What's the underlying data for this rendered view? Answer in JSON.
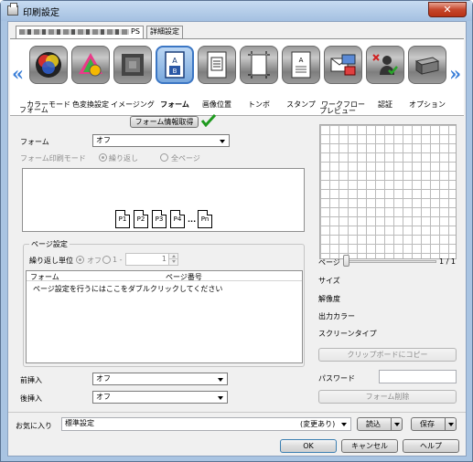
{
  "window": {
    "title": "印刷設定",
    "close_label": "✕"
  },
  "tabs": {
    "printer_tab_suffix": "PS",
    "detail_tab": "詳細設定"
  },
  "toolbar": {
    "items": [
      {
        "label": "カラーモード",
        "icon": "color-mode-icon"
      },
      {
        "label": "色変換設定",
        "icon": "color-conversion-icon"
      },
      {
        "label": "イメージング",
        "icon": "imaging-icon"
      },
      {
        "label": "フォーム",
        "icon": "form-icon",
        "selected": true
      },
      {
        "label": "画像位置",
        "icon": "image-position-icon"
      },
      {
        "label": "トンボ",
        "icon": "crop-marks-icon"
      },
      {
        "label": "スタンプ",
        "icon": "stamp-icon"
      },
      {
        "label": "ワークフロー",
        "icon": "workflow-icon"
      },
      {
        "label": "認証",
        "icon": "authentication-icon"
      },
      {
        "label": "オプション",
        "icon": "option-icon"
      }
    ],
    "prev_arrow": "«",
    "next_arrow": "»"
  },
  "form_group": {
    "title": "フォーム",
    "get_info_button": "フォーム情報取得",
    "form_label": "フォーム",
    "form_value": "オフ",
    "print_mode_label": "フォーム印刷モード",
    "mode_repeat": "繰り返し",
    "mode_all_pages": "全ページ",
    "page_icons": [
      "P1",
      "P2",
      "P3",
      "P4",
      "...",
      "Pn"
    ]
  },
  "page_settings": {
    "title": "ページ設定",
    "repeat_unit_label": "繰り返し単位",
    "off_label": "オフ",
    "range_label": "1 -",
    "range_value": "1",
    "col_form": "フォーム",
    "col_page_number": "ページ番号",
    "placeholder": "ページ設定を行うにはここをダブルクリックしてください"
  },
  "insert": {
    "front_label": "前挿入",
    "front_value": "オフ",
    "back_label": "後挿入",
    "back_value": "オフ"
  },
  "preview": {
    "title": "プレビュー",
    "page_label": "ページ",
    "page_indicator": "1 / 1",
    "size_label": "サイズ",
    "resolution_label": "解像度",
    "output_color_label": "出力カラー",
    "screen_type_label": "スクリーンタイプ",
    "copy_button": "クリップボードにコピー",
    "password_label": "パスワード",
    "password_value": "",
    "delete_form_button": "フォーム削除"
  },
  "favorites": {
    "label": "お気に入り",
    "value": "標準設定",
    "status": "(変更あり)",
    "load_button": "読込",
    "save_button": "保存"
  },
  "dialog": {
    "ok": "OK",
    "cancel": "キャンセル",
    "help": "ヘルプ"
  },
  "colors": {
    "accent_check": "#1f9a1f",
    "title_bar": "#a4c0e1",
    "selected_tool": "#79a8dd",
    "nav_arrow": "#3b7fd8"
  }
}
